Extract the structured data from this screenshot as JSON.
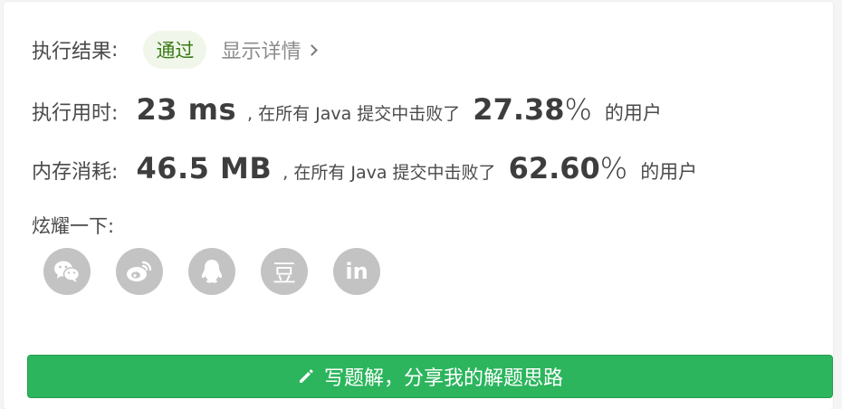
{
  "result": {
    "label": "执行结果",
    "colon": ":",
    "status": "通过",
    "details_link": "显示详情"
  },
  "runtime": {
    "label": "执行用时",
    "colon": ":",
    "value": "23 ms",
    "mid_text": ", 在所有 Java 提交中击败了",
    "percent": "27.38",
    "percent_sign": "%",
    "tail": "的用户"
  },
  "memory": {
    "label": "内存消耗",
    "colon": ":",
    "value": "46.5 MB",
    "mid_text": ", 在所有 Java 提交中击败了",
    "percent": "62.60",
    "percent_sign": "%",
    "tail": "的用户"
  },
  "share": {
    "label": "炫耀一下:",
    "buttons": [
      {
        "icon": "wechat-icon"
      },
      {
        "icon": "weibo-icon"
      },
      {
        "icon": "qq-icon"
      },
      {
        "icon": "douban-icon",
        "glyph": "豆"
      },
      {
        "icon": "linkedin-icon",
        "glyph": "in"
      }
    ]
  },
  "cta": {
    "icon": "pencil-icon",
    "label": "写题解，分享我的解题思路"
  },
  "colors": {
    "accent_green": "#2cb55d",
    "badge_bg": "#f0f7ea",
    "badge_text": "#3a7a17",
    "share_icon_bg": "#c3c3c3"
  }
}
